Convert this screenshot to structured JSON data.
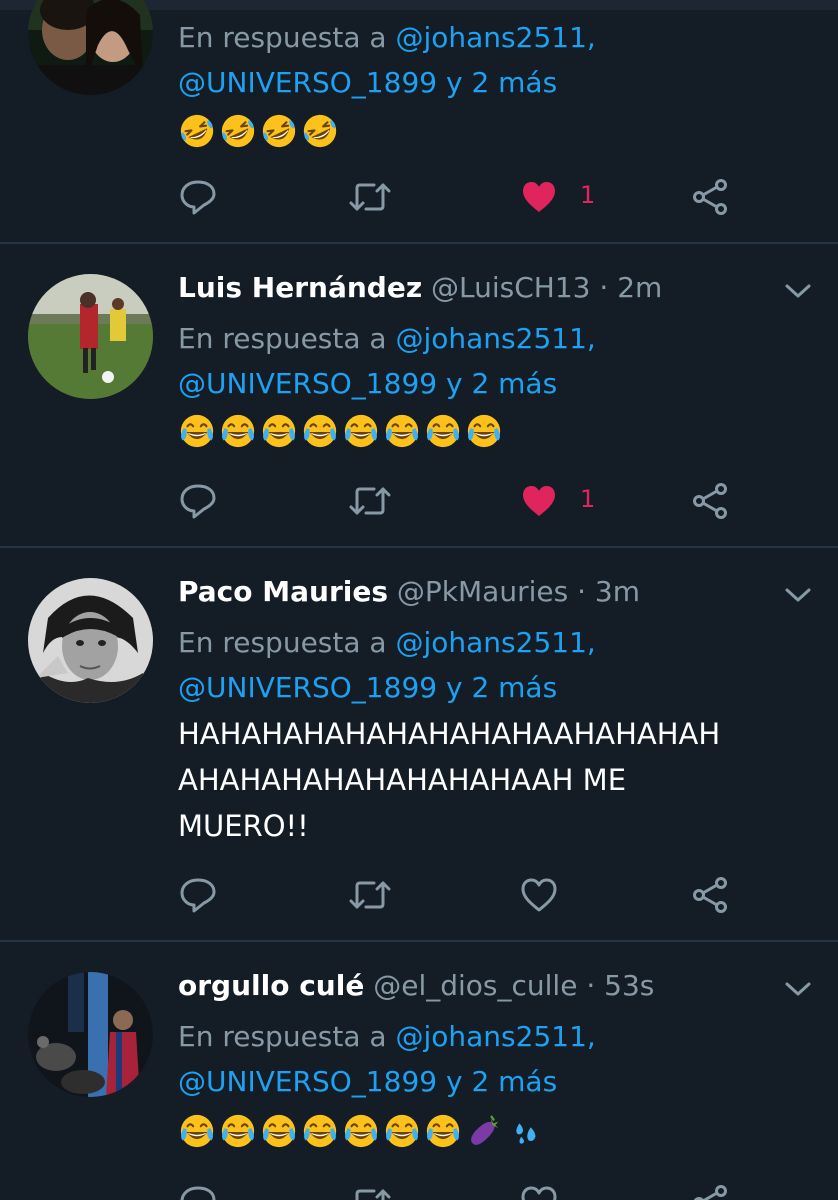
{
  "colors": {
    "background": "#141d26",
    "divider": "#243447",
    "muted": "#8899a6",
    "link": "#1da1f2",
    "like": "#e0245e"
  },
  "tweets": [
    {
      "name": "",
      "handle": "",
      "time": "",
      "reply_prefix": "En respuesta a",
      "mention_1": "@johans2511,",
      "mention_2": "@UNIVERSO_1899 y 2 más",
      "emoji": [
        "rofl-emoji",
        "rofl-emoji",
        "rofl-emoji",
        "rofl-emoji"
      ],
      "liked": true,
      "like_count": "1"
    },
    {
      "name": "Luis Hernández",
      "handle": "@LuisCH13",
      "dot": "·",
      "time": "2m",
      "reply_prefix": "En respuesta a",
      "mention_1": "@johans2511,",
      "mention_2": "@UNIVERSO_1899 y 2 más",
      "emoji": [
        "tears-of-joy-emoji",
        "tears-of-joy-emoji",
        "tears-of-joy-emoji",
        "tears-of-joy-emoji",
        "tears-of-joy-emoji",
        "tears-of-joy-emoji",
        "tears-of-joy-emoji",
        "tears-of-joy-emoji"
      ],
      "liked": true,
      "like_count": "1"
    },
    {
      "name": "Paco Mauries",
      "handle": "@PkMauries",
      "dot": "·",
      "time": "3m",
      "reply_prefix": "En respuesta a",
      "mention_1": "@johans2511,",
      "mention_2": "@UNIVERSO_1899 y 2 más",
      "text_line_1": "HAHAHAHAHAHAHAHAHAAHAHAHAH",
      "text_line_2": "AHAHAHAHAHAHAHAHAAH ME",
      "text_line_3": "MUERO!!",
      "liked": false,
      "like_count": ""
    },
    {
      "name": "orgullo culé",
      "handle": "@el_dios_culle",
      "dot": "·",
      "time": "53s",
      "reply_prefix": "En respuesta a",
      "mention_1": "@johans2511,",
      "mention_2": "@UNIVERSO_1899 y 2 más",
      "emoji": [
        "tears-of-joy-emoji",
        "tears-of-joy-emoji",
        "tears-of-joy-emoji",
        "tears-of-joy-emoji",
        "tears-of-joy-emoji",
        "tears-of-joy-emoji",
        "tears-of-joy-emoji",
        "eggplant-emoji",
        "sweat-droplets-emoji"
      ],
      "liked": false,
      "like_count": ""
    }
  ]
}
